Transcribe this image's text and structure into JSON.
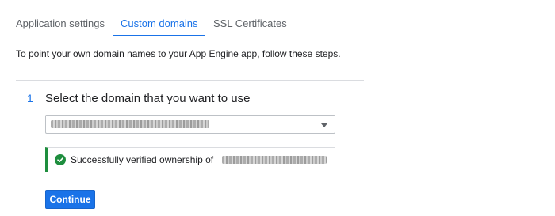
{
  "tabs": [
    {
      "label": "Application settings",
      "active": false
    },
    {
      "label": "Custom domains",
      "active": true
    },
    {
      "label": "SSL Certificates",
      "active": false
    }
  ],
  "intro_text": "To point your own domain names to your App Engine app, follow these steps.",
  "step": {
    "number": "1",
    "title": "Select the domain that you want to use",
    "domain_select": {
      "icon": "chevron-down-icon"
    },
    "notice": {
      "text": "Successfully verified ownership of",
      "icon": "check-circle-icon",
      "accent_color": "#1e8e3e"
    }
  },
  "continue_button": {
    "label": "Continue"
  },
  "colors": {
    "accent": "#1a73e8",
    "success": "#1e8e3e"
  }
}
